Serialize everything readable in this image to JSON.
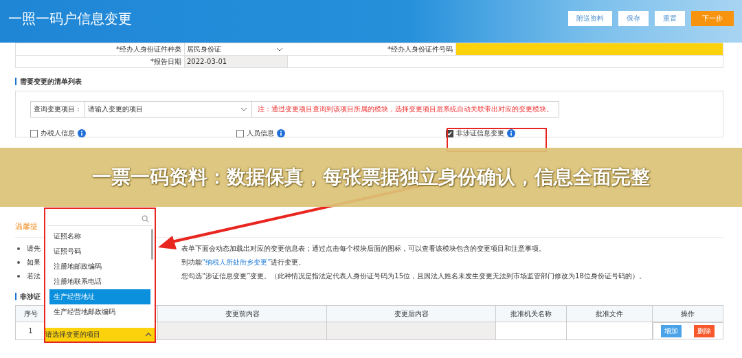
{
  "header": {
    "title": "一照一码户信息变更",
    "buttons": [
      {
        "label": "附送资料",
        "kind": "default"
      },
      {
        "label": "保存",
        "kind": "default"
      },
      {
        "label": "重置",
        "kind": "default"
      },
      {
        "label": "下一步",
        "kind": "primary"
      }
    ]
  },
  "form_rows": [
    {
      "label": "*经办人身份证件种类",
      "value": "居民身份证",
      "label_2": "*经办人身份证件号码"
    },
    {
      "label": "*报告日期",
      "value": "2022-03-01"
    }
  ],
  "list_section": {
    "title": "需要变更的清单列表",
    "query_label": "查询变更项目：",
    "query_placeholder": "请输入变更的项目",
    "note": "注：通过变更项目查询到该项目所属的模块，选择变更项目后系统自动关联带出对应的变更模块。",
    "checkboxes": [
      {
        "label": "办税人信息",
        "checked": false
      },
      {
        "label": "人员信息",
        "checked": false
      },
      {
        "label": "非涉证信息变更",
        "checked": true
      }
    ]
  },
  "banner": {
    "text": "一票一码资料：数据保真，每张票据独立身份确认，信息全面完整"
  },
  "tips": {
    "title": "温馨提",
    "items": [
      {
        "left": "请先",
        "right": "表单下面会动态加载出对应的变更信息表；通过点击每个模块后面的图标，可以查看该模块包含的变更项目和注意事项。"
      },
      {
        "left": "如果",
        "right": "到功能",
        "link": "“纳税人所处街乡变更”",
        "after": "进行变更。"
      },
      {
        "left": "若法",
        "right": "您勾选“涉证信息变更”变更。（此种情况是指法定代表人身份证号码为15位，且因法人姓名未发生变更无法到市场监管部门修改为18位身份证号码的）。"
      }
    ]
  },
  "table_section": {
    "title": "非涉证",
    "columns": [
      "序号",
      "",
      "变更前内容",
      "变更后内容",
      "批准机关名称",
      "批准文件",
      "操作"
    ],
    "rows": [
      {
        "index": "1",
        "select_placeholder": "请选择变更的项目",
        "actions": [
          {
            "label": "增加",
            "kind": "add"
          },
          {
            "label": "删除",
            "kind": "delete"
          }
        ]
      }
    ]
  },
  "dropdown": {
    "items": [
      {
        "label": "证照名称",
        "selected": false
      },
      {
        "label": "证照号码",
        "selected": false
      },
      {
        "label": "注册地邮政编码",
        "selected": false
      },
      {
        "label": "注册地联系电话",
        "selected": false
      },
      {
        "label": "生产经营地址",
        "selected": true
      },
      {
        "label": "生产经营地邮政编码",
        "selected": false
      }
    ]
  }
}
